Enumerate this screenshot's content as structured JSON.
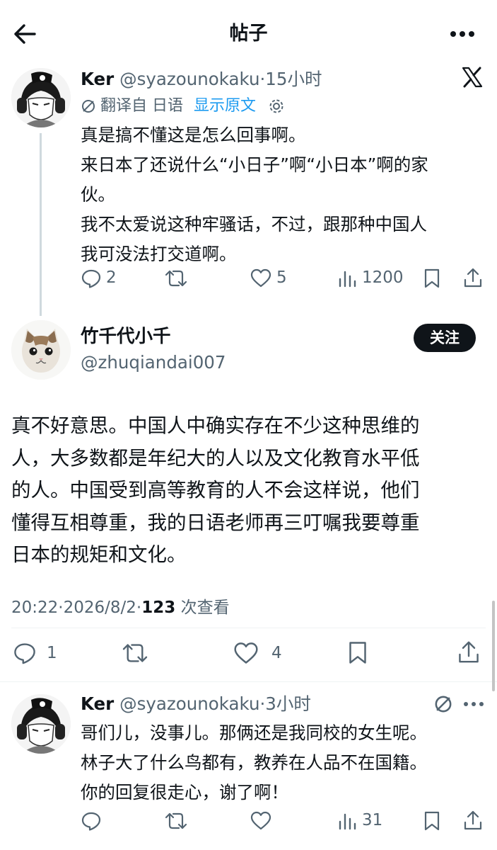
{
  "header": {
    "title": "帖子"
  },
  "parent_tweet": {
    "display_name": "Ker",
    "handle": "@syazounokaku",
    "separator": "·",
    "time": "15小时",
    "translate_label": "翻译自 日语",
    "show_original": "显示原文",
    "lines": [
      "真是搞不懂这是怎么回事啊。",
      "来日本了还说什么“小日子”啊“小日本”啊的家",
      "伙。",
      "我不太爱说这种牢骚话，不过，跟那种中国人",
      "我可没法打交道啊。"
    ],
    "stats": {
      "replies": "2",
      "likes": "5",
      "views": "1200"
    }
  },
  "main_tweet": {
    "display_name": "竹千代小千",
    "handle": "@zhuqiandai007",
    "follow_label": "关注",
    "lines": [
      "真不好意思。中国人中确实存在不少这种思维的",
      "人，大多数都是年纪大的人以及文化教育水平低",
      "的人。中国受到高等教育的人不会这样说，他们",
      "懂得互相尊重，我的日语老师再三叮嘱我要尊重",
      "日本的规矩和文化。"
    ],
    "time": "20:22",
    "separator": "·",
    "date": "2026/8/2",
    "separator2": "·",
    "views_count": "123",
    "views_label": "次查看",
    "stats": {
      "replies": "1",
      "likes": "4"
    }
  },
  "reply_tweet": {
    "display_name": "Ker",
    "handle": "@syazounokaku",
    "separator": "·",
    "time": "3小时",
    "lines": [
      "哥们儿，没事儿。那俩还是我同校的女生呢。",
      "林子大了什么鸟都有，教养在人品不在国籍。",
      "你的回复很走心，谢了啊！"
    ],
    "stats": {
      "views": "31"
    }
  },
  "colors": {
    "text": "#0f1419",
    "muted": "#536471",
    "link": "#1d9bf0",
    "divider": "#eff3f4",
    "button_bg": "#0f1419"
  }
}
